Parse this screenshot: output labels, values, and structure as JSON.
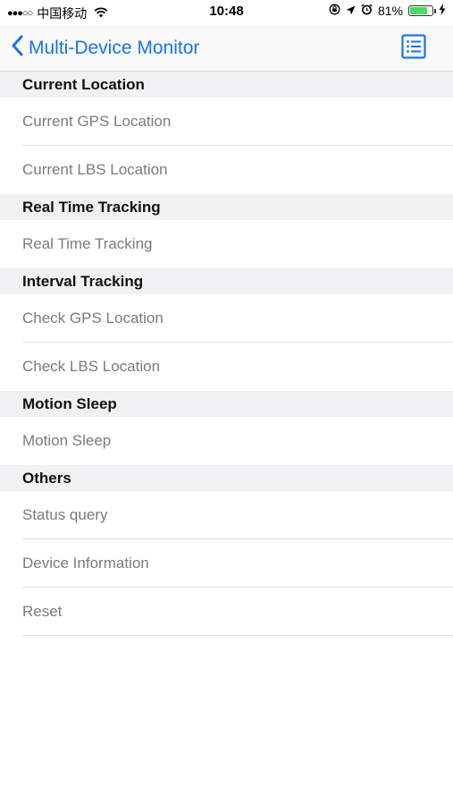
{
  "status_bar": {
    "signal": "●●●○○",
    "carrier": "中国移动",
    "time": "10:48",
    "battery_percent": "81%",
    "battery_level": 0.81
  },
  "nav": {
    "title": "Multi-Device Monitor",
    "accent_color": "#1a73e8"
  },
  "sections": [
    {
      "header": "Current Location",
      "rows": [
        "Current GPS Location",
        "Current LBS Location"
      ]
    },
    {
      "header": "Real Time Tracking",
      "rows": [
        "Real Time Tracking"
      ]
    },
    {
      "header": "Interval Tracking",
      "rows": [
        "Check GPS Location",
        "Check LBS Location"
      ]
    },
    {
      "header": "Motion Sleep",
      "rows": [
        "Motion Sleep"
      ]
    },
    {
      "header": "Others",
      "rows": [
        "Status query",
        "Device Information",
        "Reset"
      ]
    }
  ]
}
